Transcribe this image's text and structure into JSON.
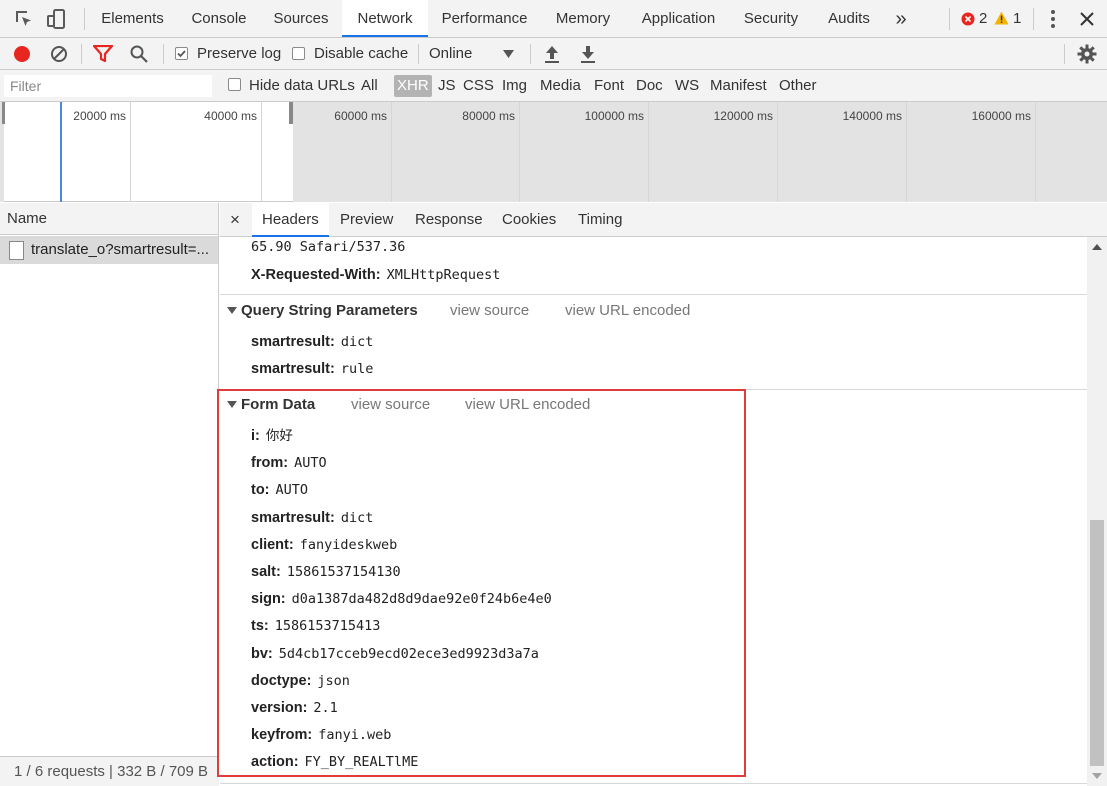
{
  "main_tabs": [
    "Elements",
    "Console",
    "Sources",
    "Network",
    "Performance",
    "Memory",
    "Application",
    "Security",
    "Audits"
  ],
  "active_main_tab": "Network",
  "more_tabs_glyph": "»",
  "errors": "2",
  "warnings": "1",
  "toolbar": {
    "preserve_log": "Preserve log",
    "disable_cache": "Disable cache",
    "throttle": "Online"
  },
  "filter": {
    "placeholder": "Filter",
    "hide_data_urls": "Hide data URLs",
    "types": [
      "All",
      "XHR",
      "JS",
      "CSS",
      "Img",
      "Media",
      "Font",
      "Doc",
      "WS",
      "Manifest",
      "Other"
    ],
    "active_type": "XHR"
  },
  "overview": {
    "ticks": [
      "20000 ms",
      "40000 ms",
      "60000 ms",
      "80000 ms",
      "100000 ms",
      "120000 ms",
      "140000 ms",
      "160000 ms"
    ]
  },
  "name_column": {
    "header": "Name",
    "request": "translate_o?smartresult=...",
    "status": "1 / 6 requests  |  332 B / 709 B"
  },
  "detail_tabs": [
    "Headers",
    "Preview",
    "Response",
    "Cookies",
    "Timing"
  ],
  "active_detail_tab": "Headers",
  "close_glyph": "×",
  "headers_tail": {
    "ua_tail": "65.90 Safari/537.36",
    "x_requested_with": {
      "key": "X-Requested-With:",
      "value": "XMLHttpRequest"
    }
  },
  "query_string": {
    "title": "Query String Parameters",
    "view_source": "view source",
    "view_url_encoded": "view URL encoded",
    "params": [
      {
        "key": "smartresult:",
        "value": "dict"
      },
      {
        "key": "smartresult:",
        "value": "rule"
      }
    ]
  },
  "form_data": {
    "title": "Form Data",
    "view_source": "view source",
    "view_url_encoded": "view URL encoded",
    "params": [
      {
        "key": "i:",
        "value": "你好"
      },
      {
        "key": "from:",
        "value": "AUTO"
      },
      {
        "key": "to:",
        "value": "AUTO"
      },
      {
        "key": "smartresult:",
        "value": "dict"
      },
      {
        "key": "client:",
        "value": "fanyideskweb"
      },
      {
        "key": "salt:",
        "value": "15861537154130"
      },
      {
        "key": "sign:",
        "value": "d0a1387da482d8d9dae92e0f24b6e4e0"
      },
      {
        "key": "ts:",
        "value": "1586153715413"
      },
      {
        "key": "bv:",
        "value": "5d4cb17cceb9ecd02ece3ed9923d3a7a"
      },
      {
        "key": "doctype:",
        "value": "json"
      },
      {
        "key": "version:",
        "value": "2.1"
      },
      {
        "key": "keyfrom:",
        "value": "fanyi.web"
      },
      {
        "key": "action:",
        "value": "FY_BY_REALTlME"
      }
    ]
  },
  "colors": {
    "accent": "#1a73e8",
    "record": "#e8251f",
    "highlight": "#e03c3c",
    "error": "#e8251f",
    "warning": "#f4b400"
  }
}
